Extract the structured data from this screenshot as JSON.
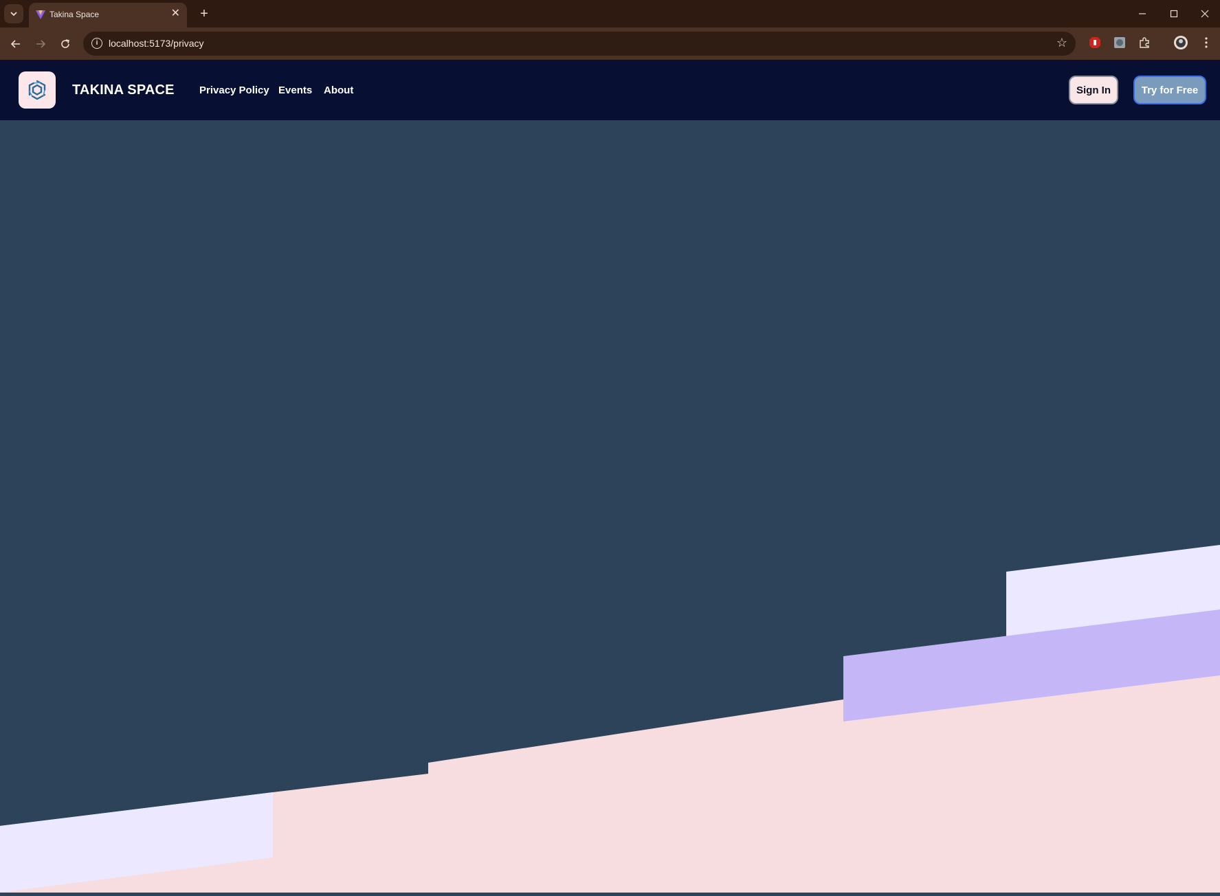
{
  "browser": {
    "tab_title": "Takina Space",
    "url": "localhost:5173/privacy",
    "new_tab_symbol": "+",
    "tab_close_symbol": "✕",
    "icons": [
      "tab-list-icon",
      "favicon-icon",
      "close-icon",
      "plus-icon",
      "minimize-icon",
      "maximize-icon",
      "window-close-icon",
      "back-icon",
      "forward-icon",
      "reload-icon",
      "info-icon",
      "star-icon",
      "adblock-extension-icon",
      "extension-icon",
      "puzzle-icon",
      "profile-avatar-icon",
      "menu-icon"
    ]
  },
  "header": {
    "brand": "TAKINA SPACE",
    "nav": [
      {
        "label": "Privacy Policy"
      },
      {
        "label": "Events"
      },
      {
        "label": "About"
      }
    ],
    "sign_in_label": "Sign In",
    "try_free_label": "Try for Free"
  },
  "colors": {
    "header_bg": "#070f33",
    "hero_bg": "#2d4359",
    "shape_lavender": "#ebe8ff",
    "shape_purple": "#c5b6f8",
    "shape_pink": "#f8dde0",
    "try_free_bg": "#7b9bbd",
    "sign_in_bg": "#f9e6e8"
  }
}
